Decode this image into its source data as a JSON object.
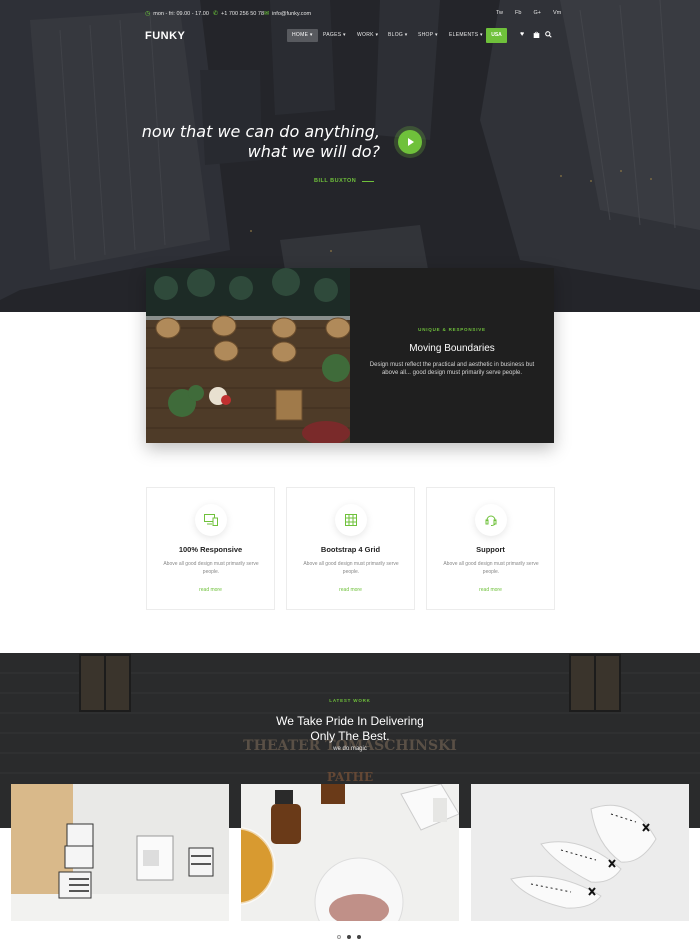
{
  "topbar": {
    "hours": "mon - fri: 09.00 - 17.00",
    "phone": "+1 700 256 50 78",
    "email": "info@funky.com",
    "social": [
      "Tw",
      "Fb",
      "G+",
      "Vm"
    ]
  },
  "header": {
    "logo": "FUNKY",
    "nav": [
      "HOME",
      "PAGES",
      "WORK",
      "BLOG",
      "SHOP",
      "ELEMENTS"
    ],
    "lang": "USA"
  },
  "hero": {
    "quote_line1": "now that we can do anything,",
    "quote_line2": "what we will do?",
    "author": "BILL BUXTON"
  },
  "feature": {
    "eyebrow": "UNIQUE & RESPONSIVE",
    "title": "Moving Boundaries",
    "text": "Design must reflect the practical and aesthetic in business but above all... good design must primarily serve people."
  },
  "services": [
    {
      "title": "100% Responsive",
      "text": "Above all good design must primarily serve people.",
      "link": "read more",
      "icon": "devices-icon"
    },
    {
      "title": "Bootstrap 4 Grid",
      "text": "Above all good design must primarily serve people.",
      "link": "read more",
      "icon": "grid-icon"
    },
    {
      "title": "Support",
      "text": "Above all good design must primarily serve people.",
      "link": "read more",
      "icon": "headset-icon"
    }
  ],
  "work": {
    "eyebrow": "LATEST WORK",
    "title_line1": "We Take Pride In Delivering",
    "title_line2": "Only The Best.",
    "subtitle": "we do magic",
    "sign_text": "THEATER TOMASCHINSKI",
    "sign_text2": "PATHE"
  },
  "colors": {
    "accent": "#6fc13b",
    "dark": "#1f1f1f"
  },
  "carousel": {
    "pages": 3,
    "active": 0
  }
}
